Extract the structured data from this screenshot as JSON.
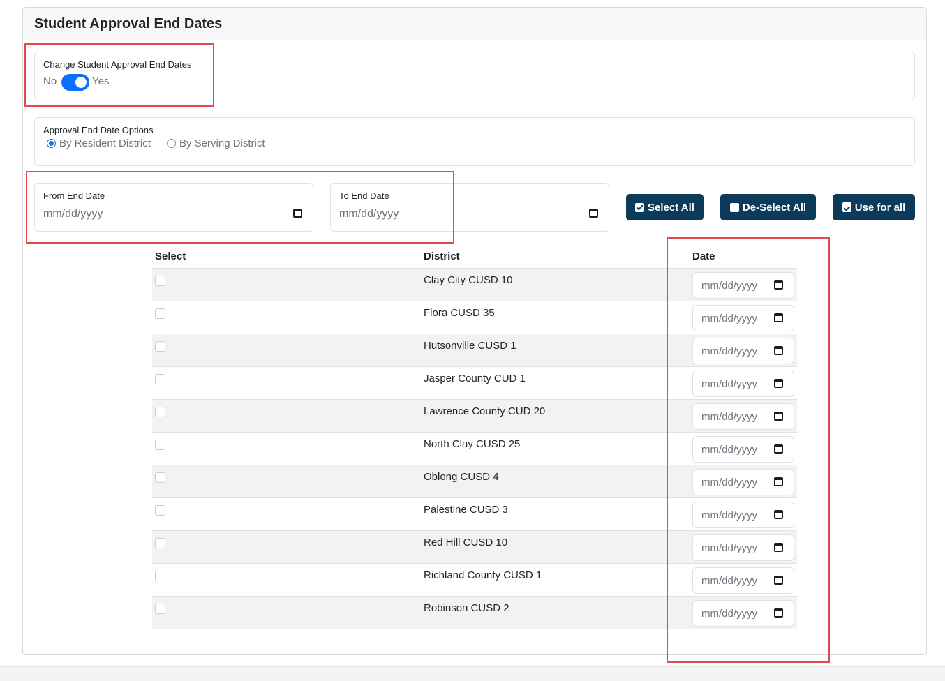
{
  "card": {
    "title": "Student Approval End Dates"
  },
  "change_dates": {
    "label": "Change Student Approval End Dates",
    "no": "No",
    "yes": "Yes",
    "enabled": true
  },
  "options": {
    "label": "Approval End Date Options",
    "resident": "By Resident District",
    "serving": "By Serving District",
    "selected": "By Resident District"
  },
  "from_date": {
    "label": "From End Date",
    "placeholder": "mm/dd/yyyy"
  },
  "to_date": {
    "label": "To End Date",
    "placeholder": "mm/dd/yyyy"
  },
  "buttons": {
    "select_all": "Select All",
    "deselect_all": "De-Select All",
    "use_for_all": "Use for all"
  },
  "table": {
    "headers": {
      "select": "Select",
      "district": "District",
      "date": "Date"
    },
    "date_placeholder": "mm/dd/yyyy",
    "rows": [
      {
        "district": "Clay City CUSD 10"
      },
      {
        "district": "Flora CUSD 35"
      },
      {
        "district": "Hutsonville CUSD 1"
      },
      {
        "district": "Jasper County CUD 1"
      },
      {
        "district": "Lawrence County CUD 20"
      },
      {
        "district": "North Clay CUSD 25"
      },
      {
        "district": "Oblong CUSD 4"
      },
      {
        "district": "Palestine CUSD 3"
      },
      {
        "district": "Red Hill CUSD 10"
      },
      {
        "district": "Richland County CUSD 1"
      },
      {
        "district": "Robinson CUSD 2"
      }
    ]
  },
  "icons": {
    "calendar": "calendar-icon",
    "check_square": "check-square-icon",
    "square": "square-icon",
    "calendar_check": "calendar-check-icon"
  },
  "colors": {
    "primary": "#0d6efd",
    "button": "#0b3a5a",
    "highlight": "#e34b4b",
    "stripe": "#f2f2f2"
  }
}
